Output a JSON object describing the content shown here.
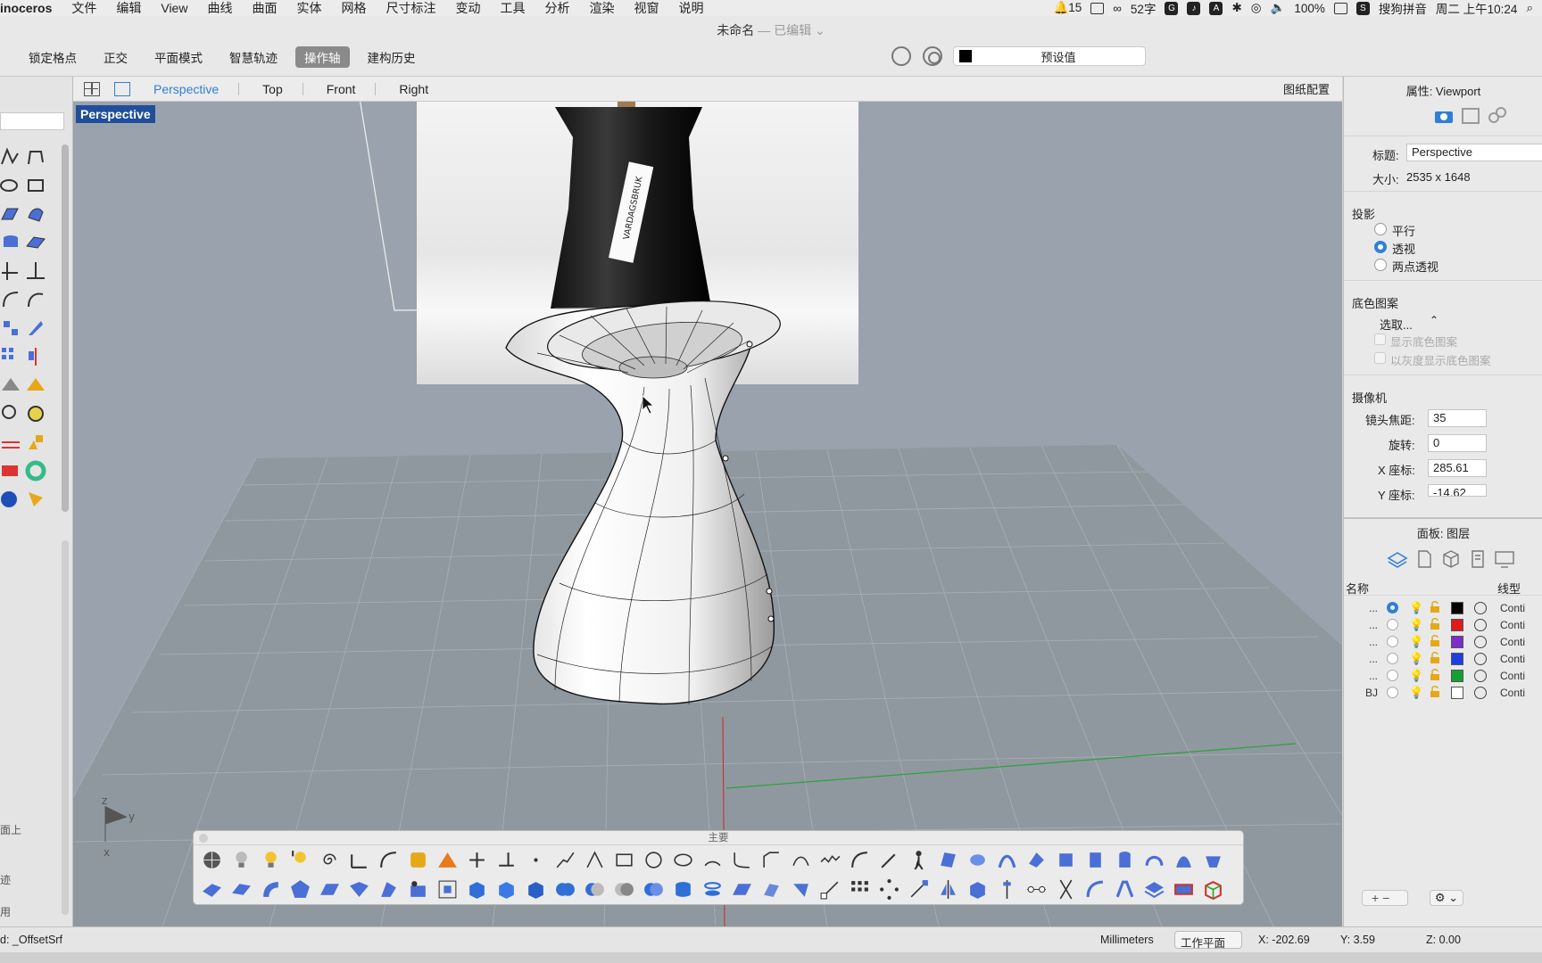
{
  "menubar": {
    "app": "inoceros",
    "items": [
      "文件",
      "编辑",
      "View",
      "曲线",
      "曲面",
      "实体",
      "网格",
      "尺寸标注",
      "变动",
      "工具",
      "分析",
      "渲染",
      "视窗",
      "说明"
    ],
    "notif_count": "15",
    "word_count": "52字",
    "battery": "100%",
    "ime": "搜狗拼音",
    "datetime": "周二 上午10:24"
  },
  "title": {
    "name": "未命名",
    "status": "— 已编辑 ⌄"
  },
  "toolbar": {
    "modes": [
      "锁定格点",
      "正交",
      "平面模式",
      "智慧轨迹",
      "操作轴",
      "建构历史"
    ],
    "active_mode": "操作轴",
    "preset_label": "预设值",
    "preset_color": "#000000"
  },
  "viewport_tabs": {
    "tabs": [
      "Perspective",
      "Top",
      "Front",
      "Right"
    ],
    "active": "Perspective",
    "layout_label": "图纸配置"
  },
  "viewport": {
    "label": "Perspective",
    "bottle_label_text": "VARDAGSBRUK",
    "axis_z": "z",
    "axis_y": "y",
    "axis_x": "x"
  },
  "main_toolbar": {
    "title": "主要"
  },
  "left_panel": {
    "texts": [
      "面上",
      "迹",
      "用"
    ]
  },
  "properties": {
    "title": "属性: Viewport",
    "title_label": "标题:",
    "title_value": "Perspective",
    "size_label": "大小:",
    "size_value": "2535 x 1648",
    "projection_label": "投影",
    "projection_options": [
      "平行",
      "透视",
      "两点透视"
    ],
    "projection_selected": "透视",
    "background_label": "底色图案",
    "select_label": "选取...",
    "show_bg": "显示底色图案",
    "gray_bg": "以灰度显示底色图案",
    "camera_label": "摄像机",
    "lens_label": "镜头焦距:",
    "lens_value": "35",
    "rotation_label": "旋转:",
    "rotation_value": "0",
    "x_label": "X 座标:",
    "x_value": "285.61",
    "y_label": "Y 座标:",
    "y_value": "-14.62"
  },
  "layers": {
    "title": "面板: 图层",
    "col_name": "名称",
    "col_linetype": "线型",
    "rows": [
      {
        "name": "...",
        "current": true,
        "color": "#000000",
        "linetype": "Conti"
      },
      {
        "name": "...",
        "current": false,
        "color": "#e01b1b",
        "linetype": "Conti"
      },
      {
        "name": "...",
        "current": false,
        "color": "#7b2fc8",
        "linetype": "Conti"
      },
      {
        "name": "...",
        "current": false,
        "color": "#1f3ee0",
        "linetype": "Conti"
      },
      {
        "name": "...",
        "current": false,
        "color": "#14a032",
        "linetype": "Conti"
      },
      {
        "name": "BJ",
        "current": false,
        "color": "#ffffff",
        "linetype": "Conti"
      }
    ],
    "add_label": "+  −",
    "gear_label": "⚙ ⌄"
  },
  "statusbar": {
    "command": "d: _OffsetSrf",
    "units": "Millimeters",
    "cplane": "工作平面 ⌃",
    "x": "X: -202.69",
    "y": "Y: 3.59",
    "z": "Z: 0.00"
  }
}
